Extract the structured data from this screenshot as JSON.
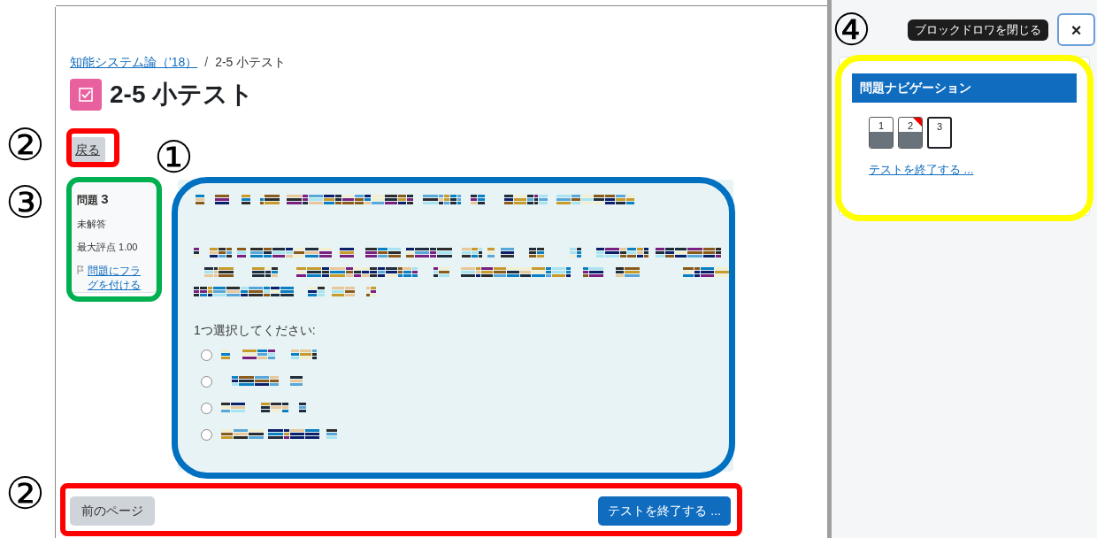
{
  "breadcrumb": [
    {
      "label": "知能システム論（'18）",
      "link": true
    },
    {
      "label": "2-5 小テスト",
      "link": false
    }
  ],
  "breadcrumb_separator": "/",
  "page_title": "2-5 小テスト",
  "back_button": "戻る",
  "question_info": {
    "heading": "問題",
    "number": "3",
    "status": "未解答",
    "max_grade": "最大評点 1.00",
    "flag_link": "問題にフラグを付ける",
    "flagged": false
  },
  "question": {
    "prompt": "1つ選択してください:",
    "options": [
      {
        "selected": false
      },
      {
        "selected": false
      },
      {
        "selected": false
      },
      {
        "selected": false
      }
    ]
  },
  "prev_button": "前のページ",
  "finish_button": "テストを終了する ...",
  "drawer": {
    "tooltip": "ブロックドロワを閉じる",
    "close_button": "×",
    "block_title": "問題ナビゲーション",
    "nav": [
      {
        "label": "1",
        "answered": true,
        "flagged": false,
        "current": false
      },
      {
        "label": "2",
        "answered": true,
        "flagged": true,
        "current": false
      },
      {
        "label": "3",
        "answered": false,
        "flagged": false,
        "current": true
      }
    ],
    "finish_link": "テストを終了する ..."
  },
  "callouts": [
    {
      "label": "①"
    },
    {
      "label": "②"
    },
    {
      "label": "③"
    },
    {
      "label": "②"
    },
    {
      "label": "④"
    }
  ],
  "highlight_frames": [
    {
      "color": "#ff0000"
    },
    {
      "color": "#00b050"
    },
    {
      "color": "#0070c0"
    },
    {
      "color": "#ff0000"
    },
    {
      "color": "#ffff00"
    }
  ]
}
